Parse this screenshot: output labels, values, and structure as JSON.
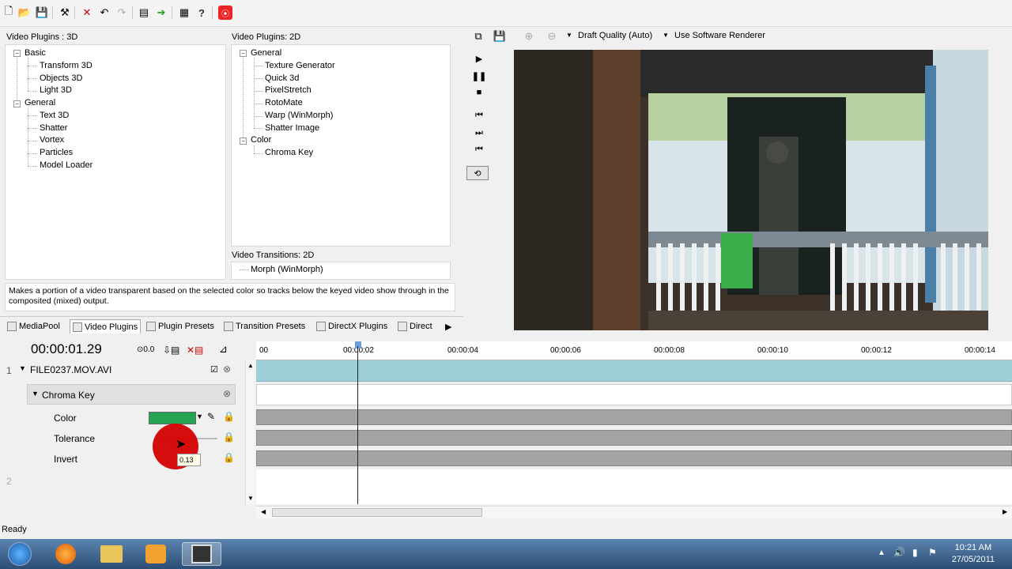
{
  "toolbar": {
    "icons": [
      "new-icon",
      "open-icon",
      "save-icon",
      "wand-icon",
      "delete-icon",
      "undo-icon",
      "redo-icon",
      "render-icon",
      "go-icon",
      "properties-icon",
      "help-icon",
      "record-icon"
    ]
  },
  "plugins3d": {
    "title": "Video Plugins : 3D",
    "groups": [
      {
        "label": "Basic",
        "items": [
          "Transform 3D",
          "Objects 3D",
          "Light 3D"
        ]
      },
      {
        "label": "General",
        "items": [
          "Text 3D",
          "Shatter",
          "Vortex",
          "Particles",
          "Model Loader"
        ]
      }
    ]
  },
  "plugins2d": {
    "title": "Video Plugins: 2D",
    "groups": [
      {
        "label": "General",
        "items": [
          "Texture Generator",
          "Quick 3d",
          "PixelStretch",
          "RotoMate",
          "Warp (WinMorph)",
          "Shatter Image"
        ]
      },
      {
        "label": "Color",
        "items": [
          "Chroma Key"
        ]
      }
    ]
  },
  "transitions2d": {
    "title": "Video Transitions: 2D",
    "items": [
      "Morph (WinMorph)"
    ]
  },
  "description": "Makes a portion of a video transparent based on the selected color so tracks below the keyed video show through in the composited (mixed) output.",
  "tabs": [
    "MediaPool",
    "Video Plugins",
    "Plugin Presets",
    "Transition Presets",
    "DirectX Plugins",
    "Direct"
  ],
  "preview": {
    "quality": "Draft Quality (Auto)",
    "renderer": "Use Software Renderer"
  },
  "timeline": {
    "time": "00:00:01.29",
    "speed": "0.0",
    "ticks": [
      "00",
      "00:00:02",
      "00:00:04",
      "00:00:06",
      "00:00:08",
      "00:00:10",
      "00:00:12",
      "00:00:14"
    ],
    "track1": {
      "number": "1",
      "name": "FILE0237.MOV.AVI"
    },
    "effect": {
      "name": "Chroma Key"
    },
    "params": [
      "Color",
      "Tolerance",
      "Invert"
    ],
    "tooltip": "0.13",
    "track2": {
      "number": "2"
    }
  },
  "status": "Ready",
  "taskbar": {
    "time": "10:21 AM",
    "date": "27/05/2011",
    "colors": {
      "accent": "#23a552"
    }
  }
}
